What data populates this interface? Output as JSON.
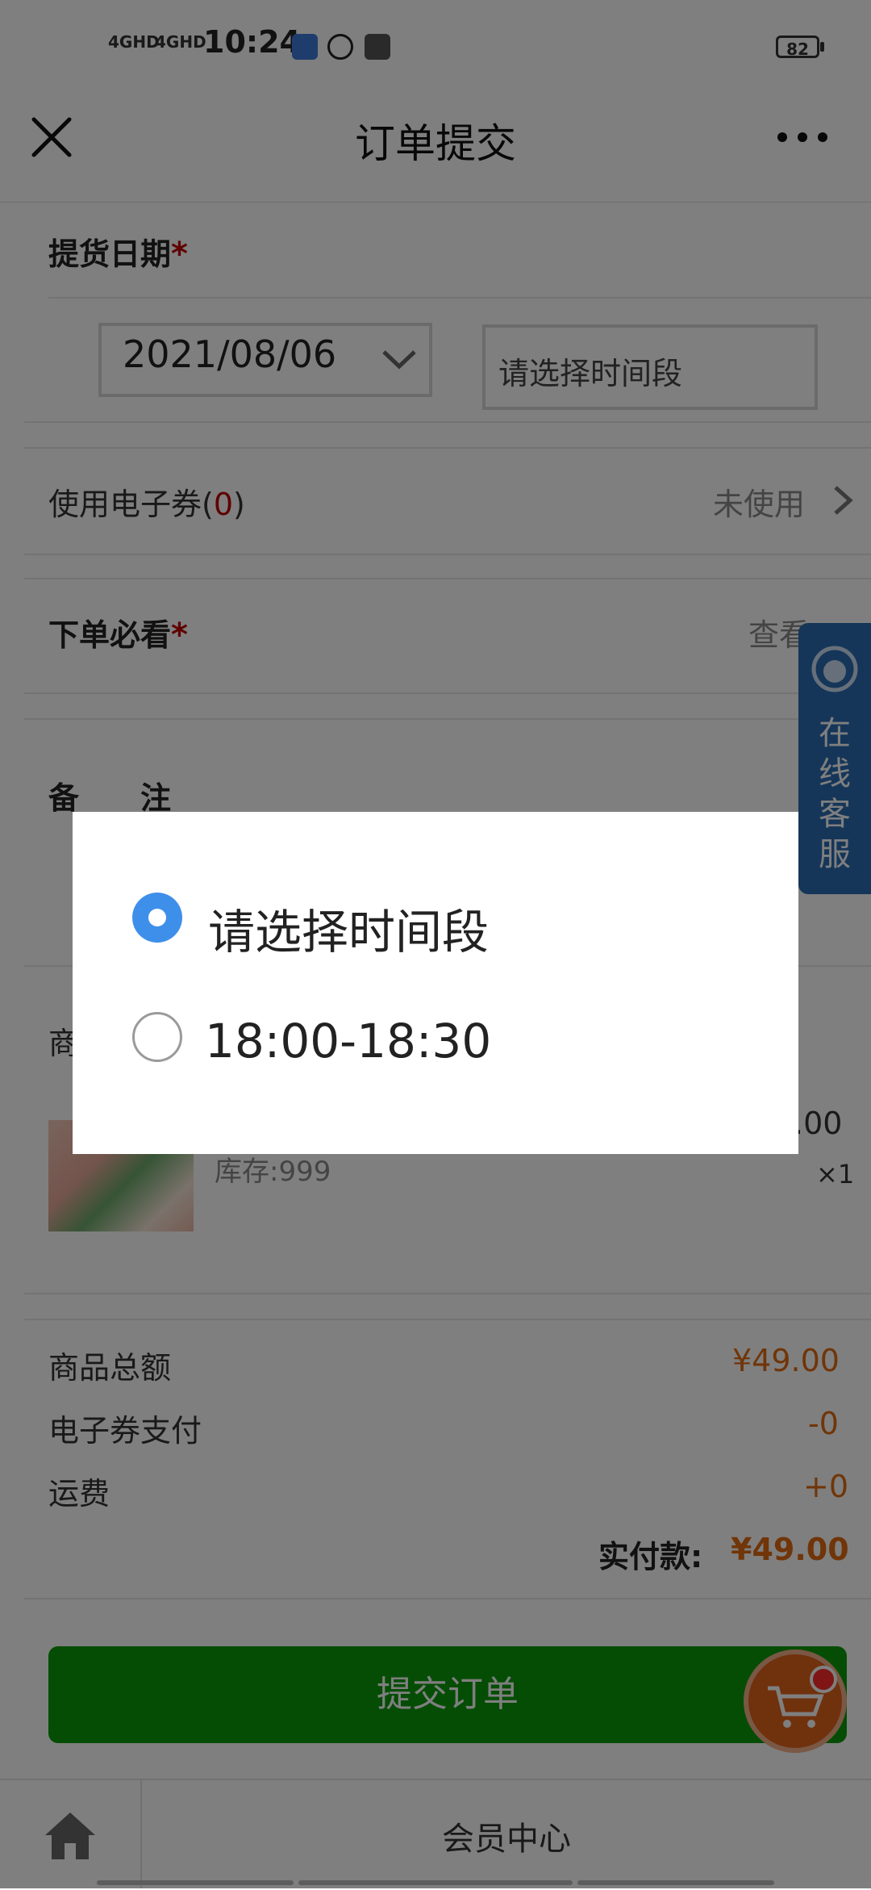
{
  "status_bar": {
    "signal1": "4GHD",
    "signal2": "4GHD",
    "time": "10:24",
    "battery": "82"
  },
  "header": {
    "title": "订单提交",
    "close_icon": "close-icon",
    "more_icon": "more-icon"
  },
  "pickup": {
    "label": "提货日期",
    "required_mark": "*",
    "date": "2021/08/06",
    "time_placeholder": "请选择时间段"
  },
  "coupon": {
    "label": "使用电子券(",
    "count": "0",
    "label_close": ")",
    "status": "未使用"
  },
  "must_read": {
    "label": "下单必看",
    "required_mark": "*",
    "action": "查看"
  },
  "remark": {
    "label": "备　　注"
  },
  "product": {
    "section_label_partial": "商",
    "price_partial": ".00",
    "stock": "库存:999",
    "qty": "×1"
  },
  "summary": {
    "goods_total_label": "商品总额",
    "goods_total": "¥49.00",
    "coupon_pay_label": "电子券支付",
    "coupon_pay": "-0",
    "shipping_label": "运费",
    "shipping": "+0",
    "paid_label": "实付款:",
    "paid": "¥49.00"
  },
  "submit_label": "提交订单",
  "customer_service": "在线客服",
  "bottom_bar": {
    "member_center": "会员中心"
  },
  "modal": {
    "options": [
      {
        "label": "请选择时间段",
        "selected": true
      },
      {
        "label": "18:00-18:30",
        "selected": false
      }
    ]
  },
  "colors": {
    "accent_green": "#0a9a0a",
    "price_orange": "#e06a10",
    "radio_blue": "#3e8fea",
    "required_red": "#c00000",
    "service_blue": "#2b6cb3"
  }
}
